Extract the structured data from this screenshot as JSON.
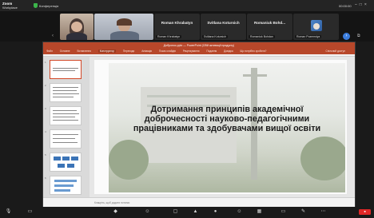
{
  "app": {
    "brand_line1": "Zoom",
    "brand_line2": "Workplace",
    "conference_label": "Конференція",
    "clock_text": "00:00:00"
  },
  "gallery": {
    "tiles": [
      {
        "name": ""
      },
      {
        "name": ""
      },
      {
        "name_top": "Roman Khrabatyn",
        "name_bottom": "Roman Khrabatyn"
      },
      {
        "name_top": "Svitlana Kotursich",
        "name_bottom": "Svitlana Kotursich"
      },
      {
        "name_top": "Romaniuk Bohd...",
        "name_bottom": "Romaniuk Bohdan"
      },
      {
        "name_top": "",
        "name_bottom": "Roman Pozemsiya"
      }
    ]
  },
  "ppt": {
    "title": "Добронос.pptx — PowerPoint (Сбій активації продукту)",
    "tabs": [
      "Файл",
      "Основне",
      "Вставлення",
      "Конструктор",
      "Переходи",
      "Анімація",
      "Показ слайдів",
      "Рецензування",
      "Подання",
      "Довідка",
      "Що потрібно зробити?"
    ],
    "active_tab": "Конструктор",
    "share_label": "Спільний доступ",
    "slide_title": "Дотримання принципів академічної доброчесності науково-педагогічними працівниками та здобувачами вищої освіти",
    "notes_placeholder": "Клацніть, щоб додати нотатки",
    "thumb_numbers": [
      "1",
      "2",
      "3",
      "4",
      "5",
      "6"
    ]
  },
  "colors": {
    "ppt_accent": "#b7472a",
    "leave": "#e02828",
    "zoom_blue": "#3b7ddd"
  }
}
